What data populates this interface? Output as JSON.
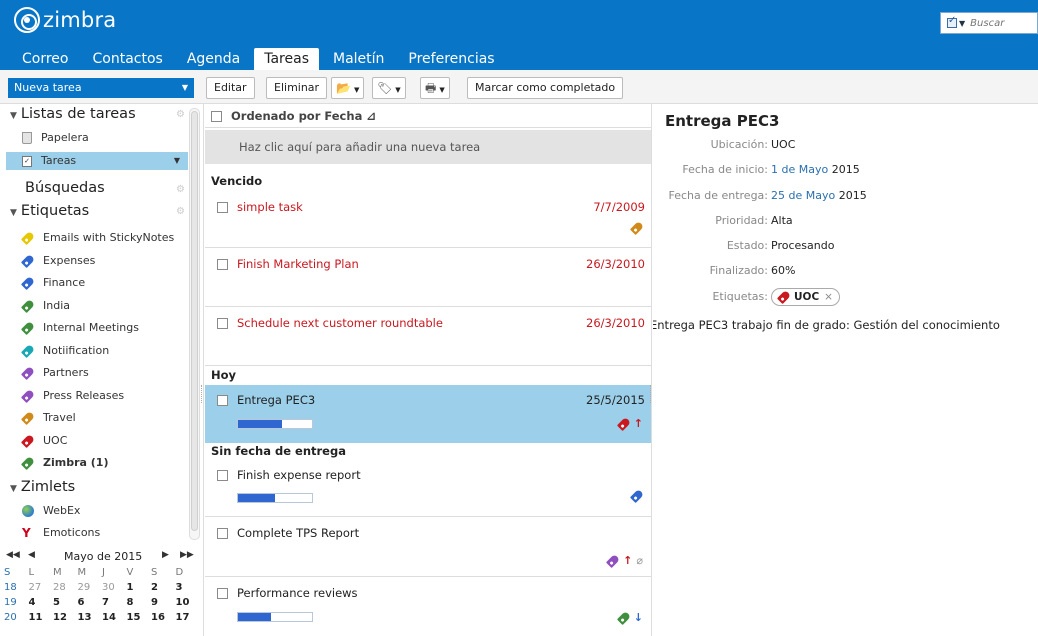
{
  "header": {
    "logo_text": "zimbra",
    "search_placeholder": "Buscar",
    "tabs": [
      "Correo",
      "Contactos",
      "Agenda",
      "Tareas",
      "Maletín",
      "Preferencias"
    ],
    "active_tab": "Tareas"
  },
  "toolbar": {
    "new_task": "Nueva tarea",
    "edit": "Editar",
    "delete": "Eliminar",
    "mark_complete": "Marcar como completado"
  },
  "sidebar": {
    "task_lists_header": "Listas de tareas",
    "trash": "Papelera",
    "tasks": "Tareas",
    "searches_header": "Búsquedas",
    "tags_header": "Etiquetas",
    "tags": [
      {
        "label": "Emails with StickyNotes",
        "color": "#e6c800"
      },
      {
        "label": "Expenses",
        "color": "#2f66cf"
      },
      {
        "label": "Finance",
        "color": "#2f66cf"
      },
      {
        "label": "India",
        "color": "#3f8f3f"
      },
      {
        "label": "Internal Meetings",
        "color": "#3f8f3f"
      },
      {
        "label": "Notiification",
        "color": "#1aa8b5"
      },
      {
        "label": "Partners",
        "color": "#8f4fbf"
      },
      {
        "label": "Press Releases",
        "color": "#8f4fbf"
      },
      {
        "label": "Travel",
        "color": "#d08a1a"
      },
      {
        "label": "UOC",
        "color": "#c9181f"
      },
      {
        "label": "Zimbra (1)",
        "color": "#3f8f3f"
      }
    ],
    "zimlets_header": "Zimlets",
    "zimlets": [
      "WebEx",
      "Emoticons"
    ]
  },
  "calendar": {
    "title": "Mayo de 2015",
    "headers": [
      "S",
      "L",
      "M",
      "M",
      "J",
      "V",
      "S",
      "D"
    ],
    "rows": [
      [
        "18",
        "27",
        "28",
        "29",
        "30",
        "1",
        "2",
        "3"
      ],
      [
        "19",
        "4",
        "5",
        "6",
        "7",
        "8",
        "9",
        "10"
      ],
      [
        "20",
        "11",
        "12",
        "13",
        "14",
        "15",
        "16",
        "17"
      ]
    ]
  },
  "list": {
    "sort_label": "Ordenado por Fecha",
    "quick_add": "Haz clic aquí para añadir una nueva tarea",
    "groups": {
      "overdue": "Vencido",
      "today": "Hoy",
      "no_due": "Sin fecha de entrega"
    },
    "tasks": [
      {
        "name": "simple task",
        "date": "7/7/2009",
        "tag_color": "#d08a1a"
      },
      {
        "name": "Finish Marketing Plan",
        "date": "26/3/2010"
      },
      {
        "name": "Schedule next customer roundtable",
        "date": "26/3/2010"
      },
      {
        "name": "Entrega PEC3",
        "date": "25/5/2015",
        "progress": 0.6,
        "tag_color": "#c9181f",
        "priority": "high"
      },
      {
        "name": "Finish expense report",
        "progress": 0.5,
        "tag_color": "#2f66cf"
      },
      {
        "name": "Complete TPS Report",
        "tag_color": "#8f4fbf",
        "priority": "high",
        "attachment": true
      },
      {
        "name": "Performance reviews",
        "progress": 0.45,
        "tag_color": "#3f8f3f",
        "priority": "low"
      }
    ]
  },
  "detail": {
    "title": "Entrega PEC3",
    "location_label": "Ubicación:",
    "location": "UOC",
    "start_label": "Fecha de inicio:",
    "start_day_month": "1 de Mayo",
    "start_year": "2015",
    "due_label": "Fecha de entrega:",
    "due_day_month": "25 de Mayo",
    "due_year": "2015",
    "priority_label": "Prioridad:",
    "priority": "Alta",
    "status_label": "Estado:",
    "status": "Procesando",
    "complete_label": "Finalizado:",
    "complete": "60%",
    "tags_label": "Etiquetas:",
    "tag": "UOC",
    "description": "Entrega PEC3 trabajo fin de grado: Gestión del conocimiento"
  }
}
